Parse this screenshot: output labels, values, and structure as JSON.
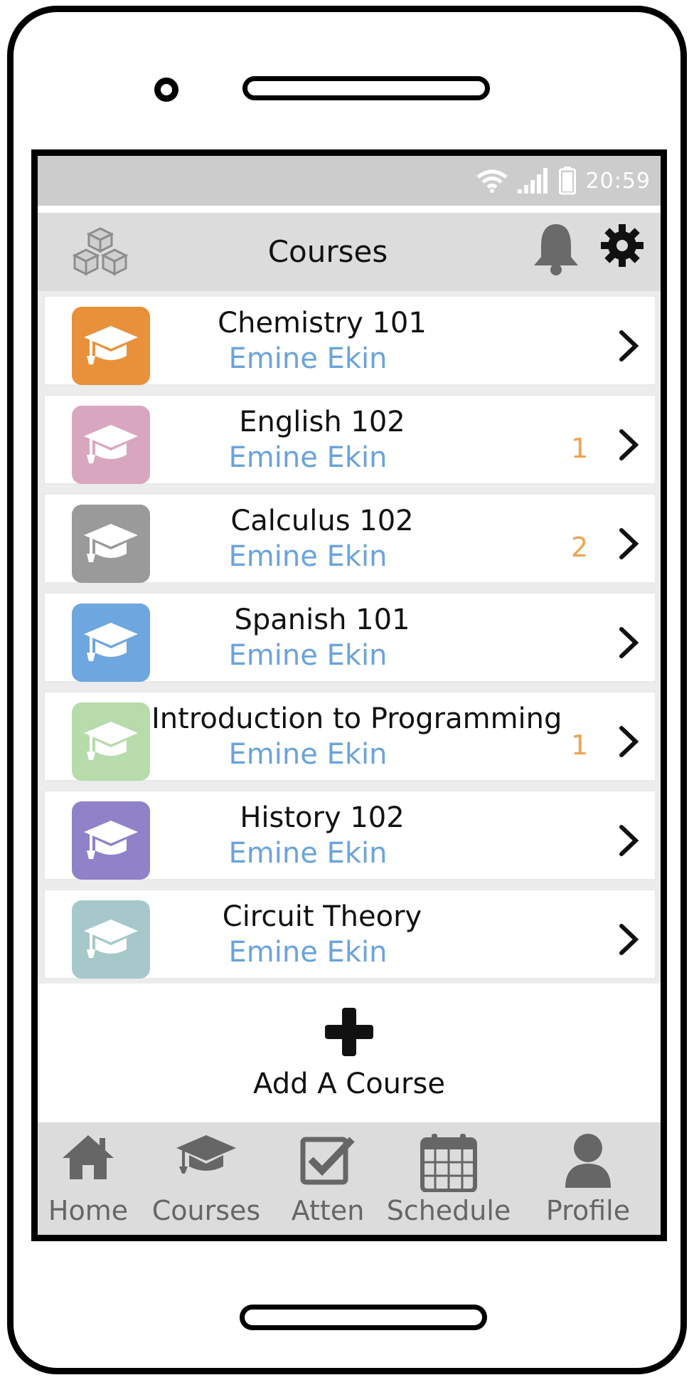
{
  "status_bar": {
    "time": "20:59",
    "icons": [
      "wifi-icon",
      "signal-icon",
      "battery-icon"
    ]
  },
  "header": {
    "title": "Courses",
    "left_icon": "cubes-logo-icon",
    "right_icons": [
      "bell-icon",
      "gear-icon"
    ]
  },
  "courses": [
    {
      "title": "Chemistry 101",
      "instructor": "Emine Ekin",
      "badge": "",
      "color": "#e8913a"
    },
    {
      "title": "English 102",
      "instructor": "Emine Ekin",
      "badge": "1",
      "color": "#d9a6c0"
    },
    {
      "title": "Calculus 102",
      "instructor": "Emine Ekin",
      "badge": "2",
      "color": "#9a9a9a"
    },
    {
      "title": "Spanish 101",
      "instructor": "Emine Ekin",
      "badge": "",
      "color": "#6ea6df"
    },
    {
      "title": "Introduction to Programming",
      "instructor": "Emine Ekin",
      "badge": "1",
      "color": "#b7dbaa"
    },
    {
      "title": "History 102",
      "instructor": "Emine Ekin",
      "badge": "",
      "color": "#8f82c8"
    },
    {
      "title": "Circuit Theory",
      "instructor": "Emine Ekin",
      "badge": "",
      "color": "#a6c8cb"
    }
  ],
  "add_course": {
    "label": "Add A Course",
    "icon": "plus-icon"
  },
  "tabs": [
    {
      "label": "Home",
      "icon": "home-icon"
    },
    {
      "label": "Courses",
      "icon": "graduation-cap-icon"
    },
    {
      "label": "Atten",
      "icon": "checkbox-icon"
    },
    {
      "label": "Schedule",
      "icon": "calendar-icon"
    },
    {
      "label": "Profile",
      "icon": "user-icon"
    }
  ],
  "colors": {
    "status_bar": "#cccccc",
    "app_bar": "#dcdcdc",
    "instructor_text": "#6aa3dc",
    "badge_text": "#f0a24f",
    "tab_icon": "#666666"
  }
}
